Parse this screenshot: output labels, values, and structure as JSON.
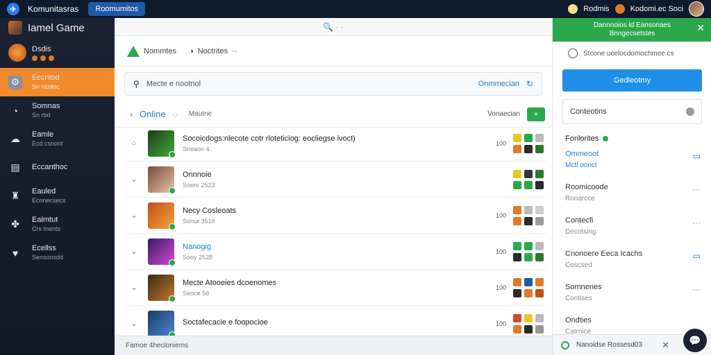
{
  "topbar": {
    "logo_glyph": "✈",
    "title": "Komunitasras",
    "tab": "Roomumitos",
    "right_label_1": "Rodmis",
    "right_label_2": "Kodomi.ec Soci"
  },
  "sidebar": {
    "header": "Iamel Game",
    "user": {
      "name": "Dsdis"
    },
    "items": [
      {
        "label": "Eccntod",
        "sub": "Sn ncotnc",
        "icon": "gear"
      },
      {
        "label": "Somnas",
        "sub": "Sn rbd",
        "icon": "chat"
      },
      {
        "label": "Eamle",
        "sub": "Ecd csnont",
        "icon": "cloud"
      },
      {
        "label": "Eccanthoc",
        "sub": "",
        "icon": "inbox"
      },
      {
        "label": "Eauled",
        "sub": "Ecnnecsecs",
        "icon": "trophy"
      },
      {
        "label": "Ealmtut",
        "sub": "Crs tnents",
        "icon": "puzzle"
      },
      {
        "label": "Ecellss",
        "sub": "Sensoosdd",
        "icon": "heart"
      }
    ]
  },
  "main": {
    "top_search_glyph": "🔍 · ·",
    "tabs": [
      {
        "label": "Nommtes"
      },
      {
        "label": "Noctrites"
      }
    ],
    "search": {
      "placeholder": "Mecte e nootnol",
      "link": "Onmmecian"
    },
    "list_header": {
      "online": "Online",
      "sub": "Mautne",
      "right": "Vonaecian",
      "btn": "+"
    },
    "rows": [
      {
        "title": "Socoicdogs:nlecote cotr rloteticiog: eocliegse ivoct)",
        "sub": "Sneaon 4",
        "num": "100",
        "blue": false,
        "thumb": [
          "#1f3a1a",
          "#3fae3a"
        ],
        "colors": [
          "#e8c62a",
          "#2ca84c",
          "#bbbbbb",
          "#e07a2c",
          "#2a2a2a",
          "#2a7a2a"
        ]
      },
      {
        "title": "Onnnoie",
        "sub": "Soenr 2523",
        "num": "",
        "blue": false,
        "thumb": [
          "#7a4a3a",
          "#e6c6a6"
        ],
        "colors": [
          "#e8c62a",
          "#333333",
          "#2a7a2a",
          "#2ca84c",
          "#2ca84c",
          "#2a2a2a"
        ]
      },
      {
        "title": "Necy Cosleoats",
        "sub": "Sonur 3518",
        "num": "100",
        "blue": false,
        "thumb": [
          "#c2501c",
          "#f2a33a"
        ],
        "colors": [
          "#e07a2c",
          "#bbbbbb",
          "#cccccc",
          "#e07a2c",
          "#2a2a2a",
          "#999999"
        ]
      },
      {
        "title": "Nanogig",
        "sub": "Sooy 2528",
        "num": "100",
        "blue": true,
        "thumb": [
          "#3a1a6a",
          "#d24ad0"
        ],
        "colors": [
          "#2ca84c",
          "#2ca84c",
          "#bbbbbb",
          "#2a2a2a",
          "#2ca84c",
          "#2a7a2a"
        ]
      },
      {
        "title": "Mecte Atooeies dcoenomes",
        "sub": "Seoce 5d",
        "num": "100",
        "blue": false,
        "thumb": [
          "#3a2a1a",
          "#c27a2a"
        ],
        "colors": [
          "#e07a2c",
          "#1f5aa8",
          "#e07a2c",
          "#2a2a2a",
          "#e07a2c",
          "#c2501c"
        ]
      },
      {
        "title": "Soctafecacie e foopocioe",
        "sub": "",
        "num": "100",
        "blue": false,
        "thumb": [
          "#1a3a6a",
          "#4a8ad0"
        ],
        "colors": [
          "#d24a2a",
          "#e8c62a",
          "#bbbbbb",
          "#e07a2c",
          "#2a2a2a",
          "#999999"
        ]
      }
    ],
    "footer": "Famoe  4hecloniems"
  },
  "right": {
    "notification": {
      "line1": "Dannnoios ld Eansonaes",
      "line2": "Bnngecsetstes"
    },
    "status": "Stcone  ucelocdomochmee  cs",
    "cta": "Gedleotmy",
    "box": "Conteotins",
    "section": "Fonlorites",
    "items": [
      {
        "title": "Ommeoot",
        "sub": "Mctl oonct",
        "title_blue": true,
        "sub_blue": true,
        "action": "▭",
        "action_blue": true
      },
      {
        "title": "Roomicoode",
        "sub": "Rooarcce",
        "title_blue": false,
        "sub_blue": false,
        "action": "···",
        "action_blue": false
      },
      {
        "title": "Contecfi",
        "sub": "Decotsing",
        "title_blue": false,
        "sub_blue": false,
        "action": "···",
        "action_blue": false
      },
      {
        "title": "Cnonoere  Eeca  Icachs",
        "sub": "Coscsed",
        "title_blue": false,
        "sub_blue": false,
        "action": "▭",
        "action_blue": true
      },
      {
        "title": "Somnenes",
        "sub": "Contises",
        "title_blue": false,
        "sub_blue": false,
        "action": "···",
        "action_blue": false
      },
      {
        "title": "Ondties",
        "sub": "Catrnice",
        "title_blue": false,
        "sub_blue": false,
        "action": "",
        "action_blue": false
      }
    ],
    "footer": "Nanoidse  Rossesd03"
  }
}
